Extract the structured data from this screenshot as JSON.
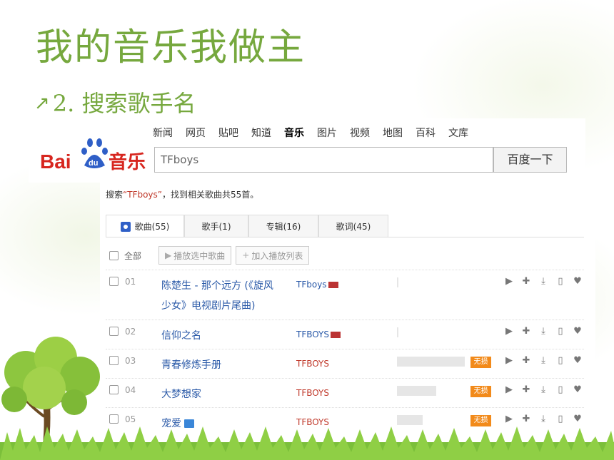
{
  "slide": {
    "title": "我的音乐我做主",
    "subtitle_marker": "↗",
    "subtitle": "2. 搜索歌手名"
  },
  "logo": {
    "text_bai": "Bai",
    "text_du": "du",
    "text_music": "音乐"
  },
  "nav": {
    "items": [
      "新闻",
      "网页",
      "贴吧",
      "知道",
      "音乐",
      "图片",
      "视频",
      "地图",
      "百科",
      "文库"
    ],
    "active": "音乐"
  },
  "search": {
    "value": "TFboys",
    "button": "百度一下"
  },
  "summary": {
    "prefix": "搜索",
    "query": "“TFboys”",
    "suffix": "，找到相关歌曲共55首。"
  },
  "tabs": [
    {
      "label": "歌曲(55)",
      "active": true
    },
    {
      "label": "歌手(1)",
      "active": false
    },
    {
      "label": "专辑(16)",
      "active": false
    },
    {
      "label": "歌词(45)",
      "active": false
    }
  ],
  "toolbar": {
    "select_all": "全部",
    "play_selected": "播放选中歌曲",
    "add_playlist": "加入播放列表"
  },
  "songs": [
    {
      "num": "01",
      "title_line1": "陈楚生 - 那个远方 (《旋风",
      "title_line2": "少女》电视剧片尾曲)",
      "artist": "TFboys",
      "popularity": 0,
      "lossless": ""
    },
    {
      "num": "02",
      "title_line1": "信仰之名",
      "title_line2": "",
      "artist": "TFBOYS",
      "popularity": 0,
      "lossless": ""
    },
    {
      "num": "03",
      "title_line1": "青春修炼手册",
      "title_line2": "",
      "artist": "TFBOYS",
      "popularity": 0.95,
      "lossless": "无损"
    },
    {
      "num": "04",
      "title_line1": "大梦想家",
      "title_line2": "",
      "artist": "TFBOYS",
      "popularity": 0.55,
      "lossless": "无损"
    },
    {
      "num": "05",
      "title_line1": "宠爱",
      "title_line2": "",
      "artist": "TFBOYS",
      "popularity": 0.36,
      "lossless": "无损"
    }
  ],
  "action_icons": [
    "play-icon",
    "add-icon",
    "download-icon",
    "phone-icon",
    "heart-icon"
  ],
  "colors": {
    "title_green": "#76a83e",
    "link_blue": "#2b5aa8",
    "artist_red": "#c0392b",
    "lossless_orange": "#f28a1a",
    "baidu_blue": "#2f5fc7",
    "baidu_red": "#d7261f"
  }
}
